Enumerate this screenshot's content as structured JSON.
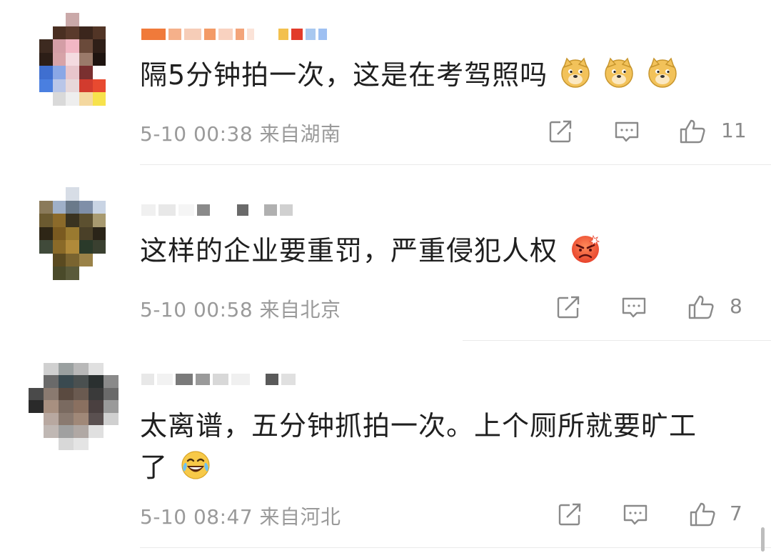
{
  "comments": [
    {
      "text": "隔5分钟拍一次，这是在考驾照吗",
      "emojis": [
        "doge-emoji",
        "doge-emoji",
        "doge-emoji"
      ],
      "time": "5-10 00:38",
      "location": "来自湖南",
      "likes": "11"
    },
    {
      "text": "这样的企业要重罚，严重侵犯人权",
      "emojis": [
        "angry-emoji"
      ],
      "time": "5-10 00:58",
      "location": "来自北京",
      "likes": "8"
    },
    {
      "text_line1": "太离谱，五分钟抓拍一次。上个厕所就要旷工",
      "text_line2": "了",
      "emojis": [
        "laugh-tears-emoji"
      ],
      "time": "5-10 08:47",
      "location": "来自河北",
      "likes": "7"
    }
  ],
  "colors": {
    "text": "#1f1f1f",
    "meta": "#9a9a9a",
    "icon": "#8a8a8a",
    "divider": "#eaeaea",
    "doge": "#f2c25a",
    "angry": "#e8432c",
    "laugh": "#f7c948"
  }
}
